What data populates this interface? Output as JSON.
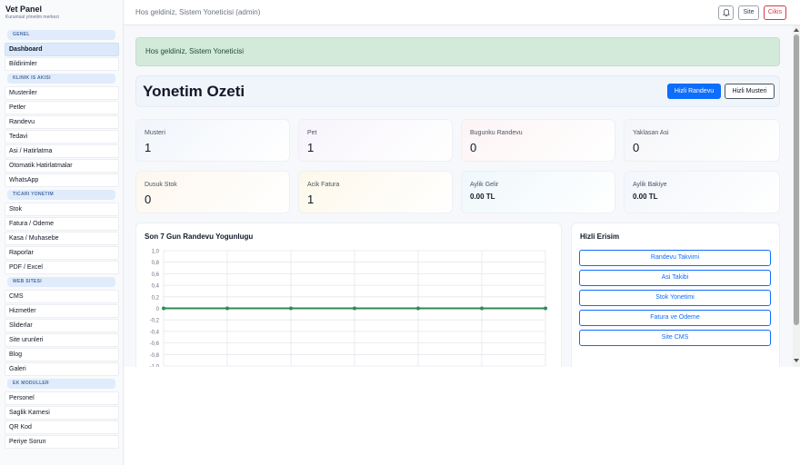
{
  "sidebar": {
    "brand_title": "Vet Panel",
    "brand_subtitle": "Kurumsal yönetim merkezi",
    "sections": [
      {
        "title": "GENEL",
        "items": [
          "Dashboard",
          "Bildirimler"
        ]
      },
      {
        "title": "KLINIK IS AKISI",
        "items": [
          "Musteriler",
          "Petler",
          "Randevu",
          "Tedavi",
          "Asi / Hatirlatma",
          "Otomatik Hatirlatmalar",
          "WhatsApp"
        ]
      },
      {
        "title": "TICARI YONETIM",
        "items": [
          "Stok",
          "Fatura / Odeme",
          "Kasa / Muhasebe",
          "Raporlar",
          "PDF / Excel"
        ]
      },
      {
        "title": "WEB SITESI",
        "items": [
          "CMS",
          "Hizmetler",
          "Sliderlar",
          "Site urunleri",
          "Blog",
          "Galeri"
        ]
      },
      {
        "title": "EK MODULLER",
        "items": [
          "Personel",
          "Saglik Karnesi",
          "QR Kod",
          "Periye Sorun"
        ]
      }
    ],
    "active_item": "Dashboard"
  },
  "topbar": {
    "welcome": "Hos geldiniz, Sistem Yoneticisi (admin)",
    "bell_icon": "bell-icon",
    "site_label": "Site",
    "logout_label": "Cikis"
  },
  "alert": {
    "text": "Hos geldiniz, Sistem Yoneticisi",
    "color": "#d3eadb"
  },
  "header": {
    "title": "Yonetim Ozeti",
    "quick_appointment": "Hizli Randevu",
    "quick_customer": "Hizli Musteri"
  },
  "stats": [
    {
      "label": "Musteri",
      "value": "1",
      "color": "#f1f5fb"
    },
    {
      "label": "Pet",
      "value": "1",
      "color": "#f7f4fb"
    },
    {
      "label": "Bugunku Randevu",
      "value": "0",
      "color": "#fdf4f4"
    },
    {
      "label": "Yaklasan Asi",
      "value": "0",
      "color": "#f5f6f8"
    },
    {
      "label": "Dusuk Stok",
      "value": "0",
      "color": "#fdf7ee"
    },
    {
      "label": "Acik Fatura",
      "value": "1",
      "color": "#fdf8ea"
    },
    {
      "label": "Aylik Gelir",
      "value": "0.00 TL",
      "color": "#eef8fb"
    },
    {
      "label": "Aylik Bakiye",
      "value": "0.00 TL",
      "color": "#f3f6fb"
    }
  ],
  "chart_card": {
    "title": "Son 7 Gun Randevu Yogunlugu"
  },
  "chart_data": {
    "type": "line",
    "title": "Son 7 Gun Randevu Yogunlugu",
    "x": [
      "",
      "",
      "",
      "",
      "",
      "",
      ""
    ],
    "series": [
      {
        "values": [
          0,
          0,
          0,
          0,
          0,
          0,
          0
        ],
        "color": "#2e8b57"
      }
    ],
    "ylim": [
      -1,
      1
    ],
    "yticks": [
      "1,0",
      "0,8",
      "0,6",
      "0,4",
      "0,2",
      "0",
      "-0,2",
      "-0,4",
      "-0,6",
      "-0,8",
      "-1,0"
    ],
    "grid": true,
    "legend": "none"
  },
  "quick_access": {
    "title": "Hizli Erisim",
    "links": [
      "Randevu Takvimi",
      "Asi Takibi",
      "Stok Yonetimi",
      "Fatura ve Odeme",
      "Site CMS"
    ]
  },
  "colors": {
    "primary": "#0d6efd",
    "danger": "#dc3545",
    "success_line": "#2e8b57"
  }
}
